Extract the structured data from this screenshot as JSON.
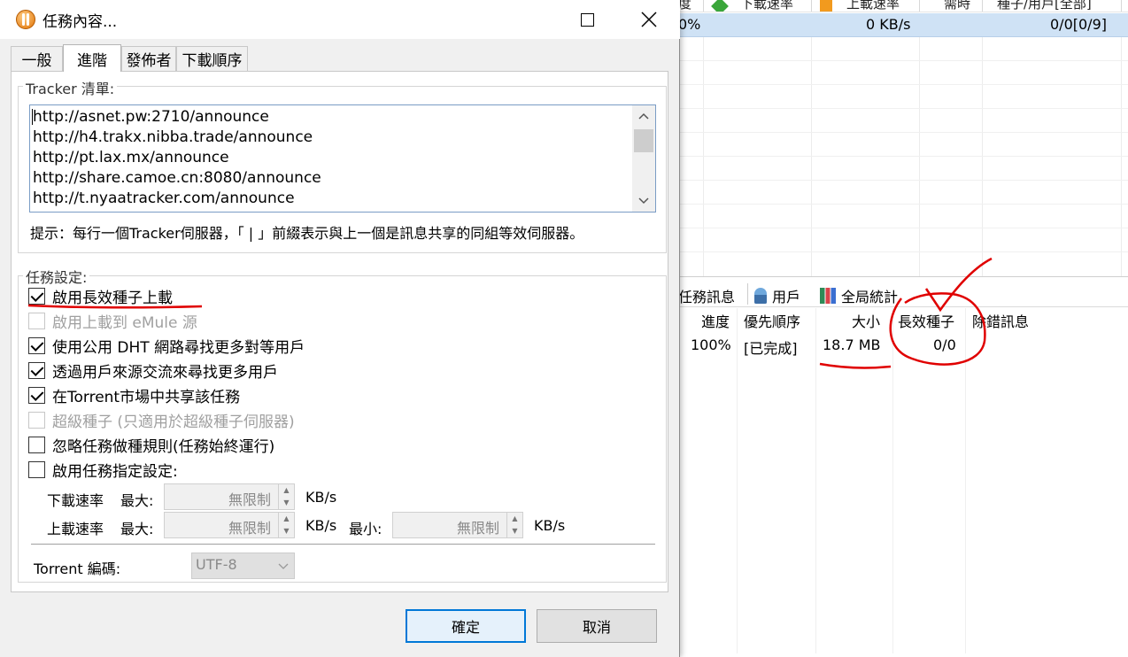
{
  "dialog": {
    "title": "任務內容...",
    "tabs": [
      "一般",
      "進階",
      "發佈者",
      "下載順序"
    ],
    "active_tab": "進階",
    "tracker": {
      "group_label": "Tracker 清單:",
      "lines": [
        "http://asnet.pw:2710/announce",
        "http://h4.trakx.nibba.trade/announce",
        "http://pt.lax.mx/announce",
        "http://share.camoe.cn:8080/announce",
        "http://t.nyaatracker.com/announce"
      ],
      "hint": "提示：每行一個Tracker伺服器，「 | 」前綴表示與上一個是訊息共享的同組等效伺服器。"
    },
    "task_settings": {
      "group_label": "任務設定:",
      "options": [
        {
          "label": "啟用長效種子上載",
          "checked": true,
          "enabled": true
        },
        {
          "label": "啟用上載到 eMule 源",
          "checked": false,
          "enabled": false
        },
        {
          "label": "使用公用 DHT 網路尋找更多對等用戶",
          "checked": true,
          "enabled": true
        },
        {
          "label": "透過用戶來源交流來尋找更多用戶",
          "checked": true,
          "enabled": true
        },
        {
          "label": "在Torrent市場中共享該任務",
          "checked": true,
          "enabled": true
        },
        {
          "label": "超級種子 (只適用於超級種子伺服器)",
          "checked": false,
          "enabled": false
        },
        {
          "label": "忽略任務做種規則(任務始終運行)",
          "checked": false,
          "enabled": true
        },
        {
          "label": "啟用任務指定設定:",
          "checked": false,
          "enabled": true
        }
      ],
      "download": {
        "label": "下載速率",
        "max_label": "最大:",
        "value": "無限制",
        "unit": "KB/s"
      },
      "upload": {
        "label": "上載速率",
        "max_label": "最大:",
        "max_value": "無限制",
        "unit": "KB/s",
        "min_label": "最小:",
        "min_value": "無限制",
        "min_unit": "KB/s"
      }
    },
    "encoding": {
      "label": "Torrent 編碼:",
      "value": "UTF-8"
    },
    "buttons": {
      "ok": "確定",
      "cancel": "取消"
    }
  },
  "background": {
    "header_cols": [
      "度",
      "下載速率",
      "上載速率",
      "需時",
      "種子/用戶[全部]"
    ],
    "row": {
      "progress": "0%",
      "upload_speed": "0 KB/s",
      "seeds_peers": "0/0[0/9]"
    },
    "bottom_tabs": [
      "任務訊息",
      "用戶",
      "全局統計"
    ],
    "detail_headers": [
      "進度",
      "優先順序",
      "大小",
      "長效種子",
      "除錯訊息"
    ],
    "detail_values": {
      "progress": "100%",
      "priority": "[已完成]",
      "size": "18.7 MB",
      "seeds": "0/0"
    }
  },
  "colors": {
    "selected_row": "#cfe2f5",
    "primary_border": "#0078d7",
    "annotation": "#e00000"
  }
}
